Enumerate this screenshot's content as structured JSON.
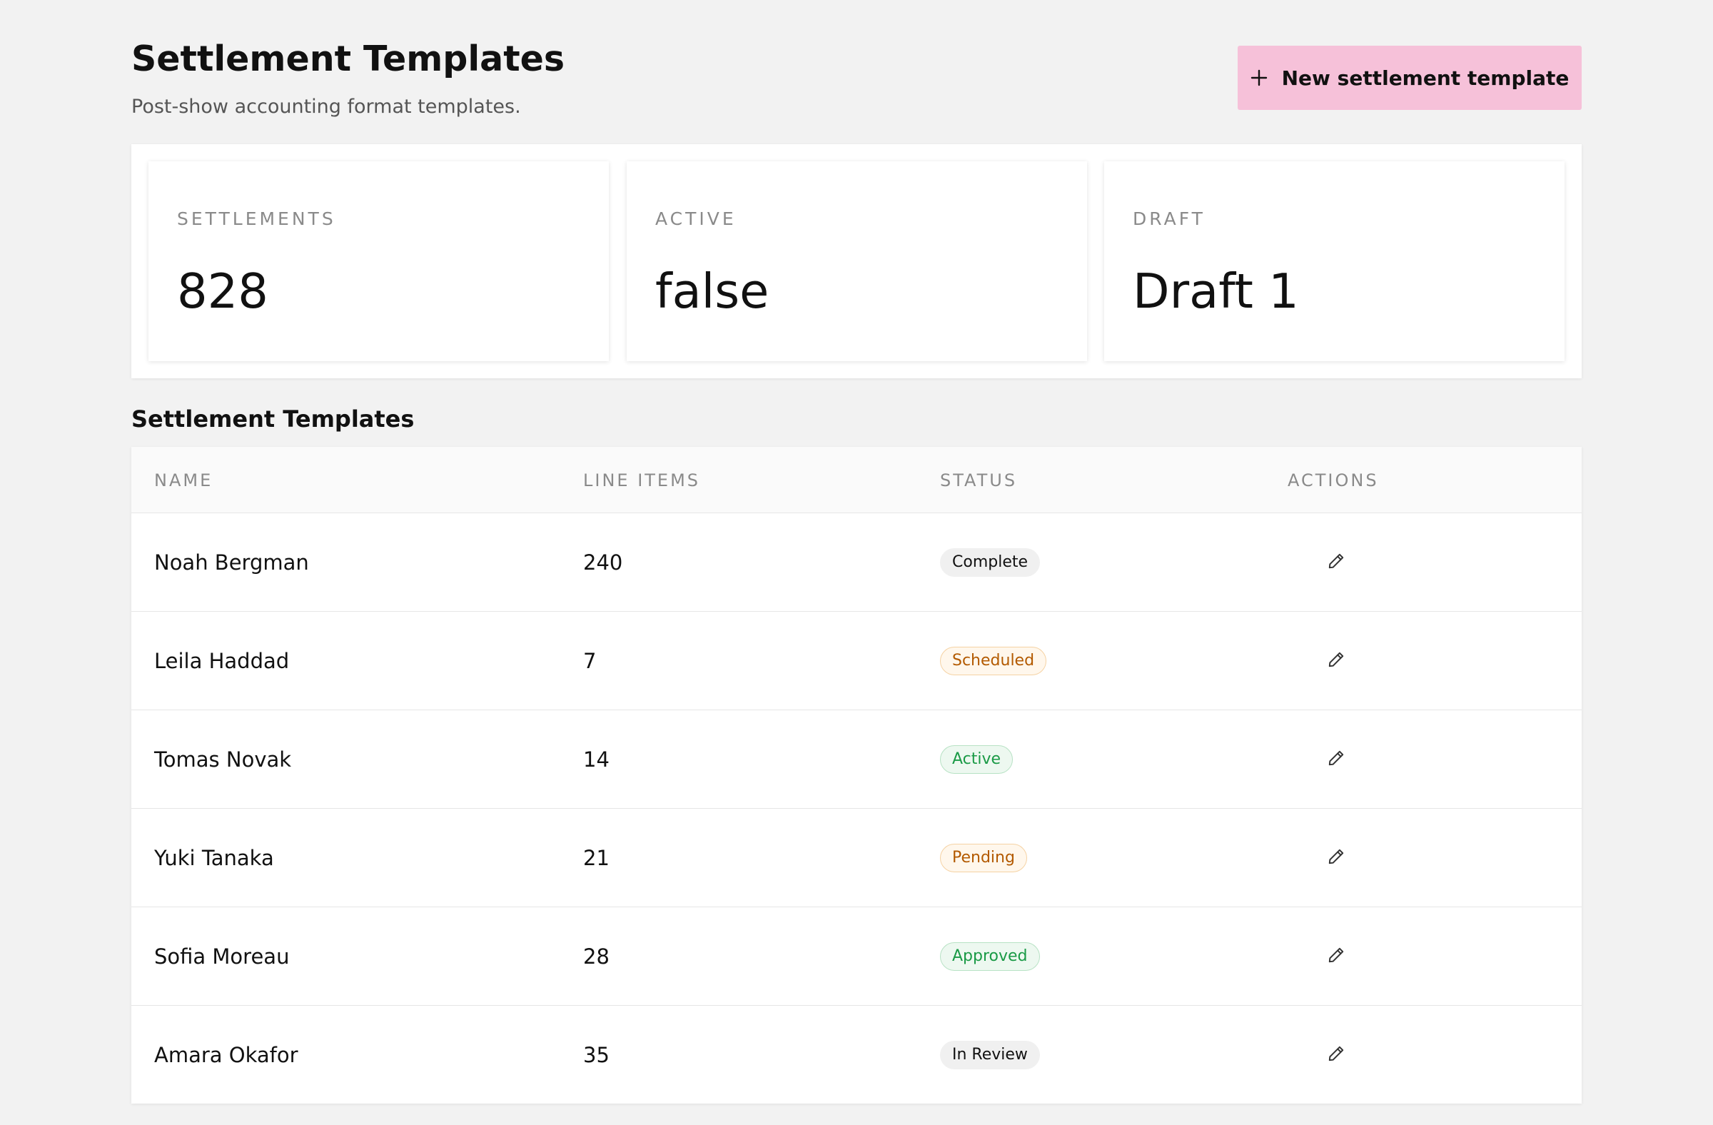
{
  "header": {
    "title": "Settlement Templates",
    "subtitle": "Post-show accounting format templates.",
    "new_button_label": "New settlement template",
    "new_button_icon": "plus-icon",
    "new_button_color": "#f6c1d9"
  },
  "stats": [
    {
      "label": "SETTLEMENTS",
      "value": "828"
    },
    {
      "label": "ACTIVE",
      "value": "false"
    },
    {
      "label": "DRAFT",
      "value": "Draft 1"
    }
  ],
  "table": {
    "title": "Settlement Templates",
    "columns": [
      "NAME",
      "LINE ITEMS",
      "STATUS",
      "ACTIONS"
    ],
    "rows": [
      {
        "name": "Noah Bergman",
        "line_items": "240",
        "status": "Complete",
        "status_type": "neutral",
        "action_icon": "pencil-icon"
      },
      {
        "name": "Leila Haddad",
        "line_items": "7",
        "status": "Scheduled",
        "status_type": "warning",
        "action_icon": "pencil-icon"
      },
      {
        "name": "Tomas Novak",
        "line_items": "14",
        "status": "Active",
        "status_type": "success",
        "action_icon": "pencil-icon"
      },
      {
        "name": "Yuki Tanaka",
        "line_items": "21",
        "status": "Pending",
        "status_type": "warning",
        "action_icon": "pencil-icon"
      },
      {
        "name": "Sofia Moreau",
        "line_items": "28",
        "status": "Approved",
        "status_type": "success",
        "action_icon": "pencil-icon"
      },
      {
        "name": "Amara Okafor",
        "line_items": "35",
        "status": "In Review",
        "status_type": "neutral",
        "action_icon": "pencil-icon"
      }
    ]
  },
  "colors": {
    "background": "#f2f2f2",
    "warning_text": "#b35a00",
    "success_text": "#1a9a46"
  }
}
